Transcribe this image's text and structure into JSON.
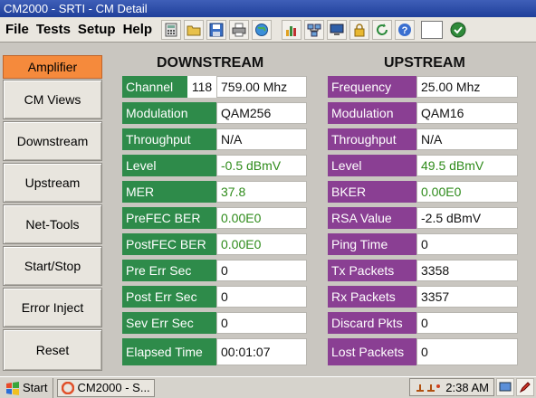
{
  "window": {
    "title": "CM2000 - SRTI - CM Detail"
  },
  "menu": {
    "items": [
      "File",
      "Tests",
      "Setup",
      "Help"
    ]
  },
  "nav": {
    "items": [
      {
        "label": "Amplifier",
        "active": true
      },
      {
        "label": "CM Views"
      },
      {
        "label": "Downstream"
      },
      {
        "label": "Upstream"
      },
      {
        "label": "Net-Tools"
      },
      {
        "label": "Start/Stop"
      },
      {
        "label": "Error Inject"
      },
      {
        "label": "Reset"
      }
    ]
  },
  "downstream": {
    "heading": "DOWNSTREAM",
    "channel_label": "Channel",
    "channel_number": "118",
    "rows": [
      {
        "label": "Channel",
        "value": "759.00 Mhz"
      },
      {
        "label": "Modulation",
        "value": "QAM256"
      },
      {
        "label": "Throughput",
        "value": "N/A"
      },
      {
        "label": "Level",
        "value": "-0.5 dBmV"
      },
      {
        "label": "MER",
        "value": "37.8"
      },
      {
        "label": "PreFEC BER",
        "value": "0.00E0"
      },
      {
        "label": "PostFEC BER",
        "value": "0.00E0"
      },
      {
        "label": "Pre Err Sec",
        "value": "0"
      },
      {
        "label": "Post Err Sec",
        "value": "0"
      },
      {
        "label": "Sev Err Sec",
        "value": "0"
      },
      {
        "label": "Elapsed Time",
        "value": "00:01:07"
      }
    ]
  },
  "upstream": {
    "heading": "UPSTREAM",
    "rows": [
      {
        "label": "Frequency",
        "value": "25.00 Mhz"
      },
      {
        "label": "Modulation",
        "value": "QAM16"
      },
      {
        "label": "Throughput",
        "value": "N/A"
      },
      {
        "label": "Level",
        "value": "49.5 dBmV"
      },
      {
        "label": "BKER",
        "value": "0.00E0"
      },
      {
        "label": "RSA Value",
        "value": "-2.5 dBmV"
      },
      {
        "label": "Ping Time",
        "value": "0"
      },
      {
        "label": "Tx Packets",
        "value": "3358"
      },
      {
        "label": "Rx Packets",
        "value": "3357"
      },
      {
        "label": "Discard Pkts",
        "value": "0"
      },
      {
        "label": "Lost Packets",
        "value": "0"
      }
    ]
  },
  "taskbar": {
    "start_label": "Start",
    "task_label": "CM2000 - S...",
    "clock": "2:38 AM"
  },
  "colors": {
    "downstream_label_bg": "#2e8b4a",
    "upstream_label_bg": "#8a3f93",
    "active_nav": "#f58a3c",
    "green_value": "#2e8b1a"
  }
}
